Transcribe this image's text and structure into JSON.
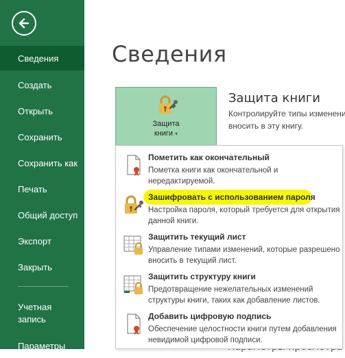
{
  "sidebar": {
    "items": [
      {
        "label": "Сведения"
      },
      {
        "label": "Создать"
      },
      {
        "label": "Открыть"
      },
      {
        "label": "Сохранить"
      },
      {
        "label": "Сохранить как"
      },
      {
        "label": "Печать"
      },
      {
        "label": "Общий доступ"
      },
      {
        "label": "Экспорт"
      },
      {
        "label": "Закрыть"
      },
      {
        "label": "Учетная\nзапись"
      },
      {
        "label": "Параметры"
      }
    ],
    "selected": "Сведения",
    "bg_color": "#217346"
  },
  "main": {
    "title": "Сведения",
    "protect_button": {
      "label_line1": "Защита",
      "label_line2": "книги"
    },
    "section_title": "Защита книги",
    "section_desc_line1": "Контролируйте типы изменений",
    "section_desc_line2": "вносить в эту книгу.",
    "bottom_clipped": "Параметры просмотра"
  },
  "menu": {
    "items": [
      {
        "title": "Пометить как окончательный",
        "desc": "Пометка книги как окончательной и нередактируемой.",
        "icon": "document-ribbon-icon"
      },
      {
        "title": "Зашифровать с использованием пароля",
        "desc": "Настройка пароля, который требуется для открытия данной книги.",
        "icon": "lock-key-icon",
        "highlighted": true
      },
      {
        "title": "Защитить текущий лист",
        "desc": "Управление типами изменений, которые разрешено вносить в текущий лист.",
        "icon": "sheet-lock-icon"
      },
      {
        "title": "Защитить структуру книги",
        "desc": "Предотвращение нежелательных изменений структуры книги, таких как добавление листов.",
        "icon": "workbook-lock-icon"
      },
      {
        "title": "Добавить цифровую подпись",
        "desc": "Обеспечение целостности книги путем добавления невидимой цифровой подписи.",
        "icon": "digital-signature-icon"
      }
    ]
  },
  "colors": {
    "accent": "#217346",
    "highlight": "#f5f500",
    "protect_bg": "#9fd5b0"
  }
}
